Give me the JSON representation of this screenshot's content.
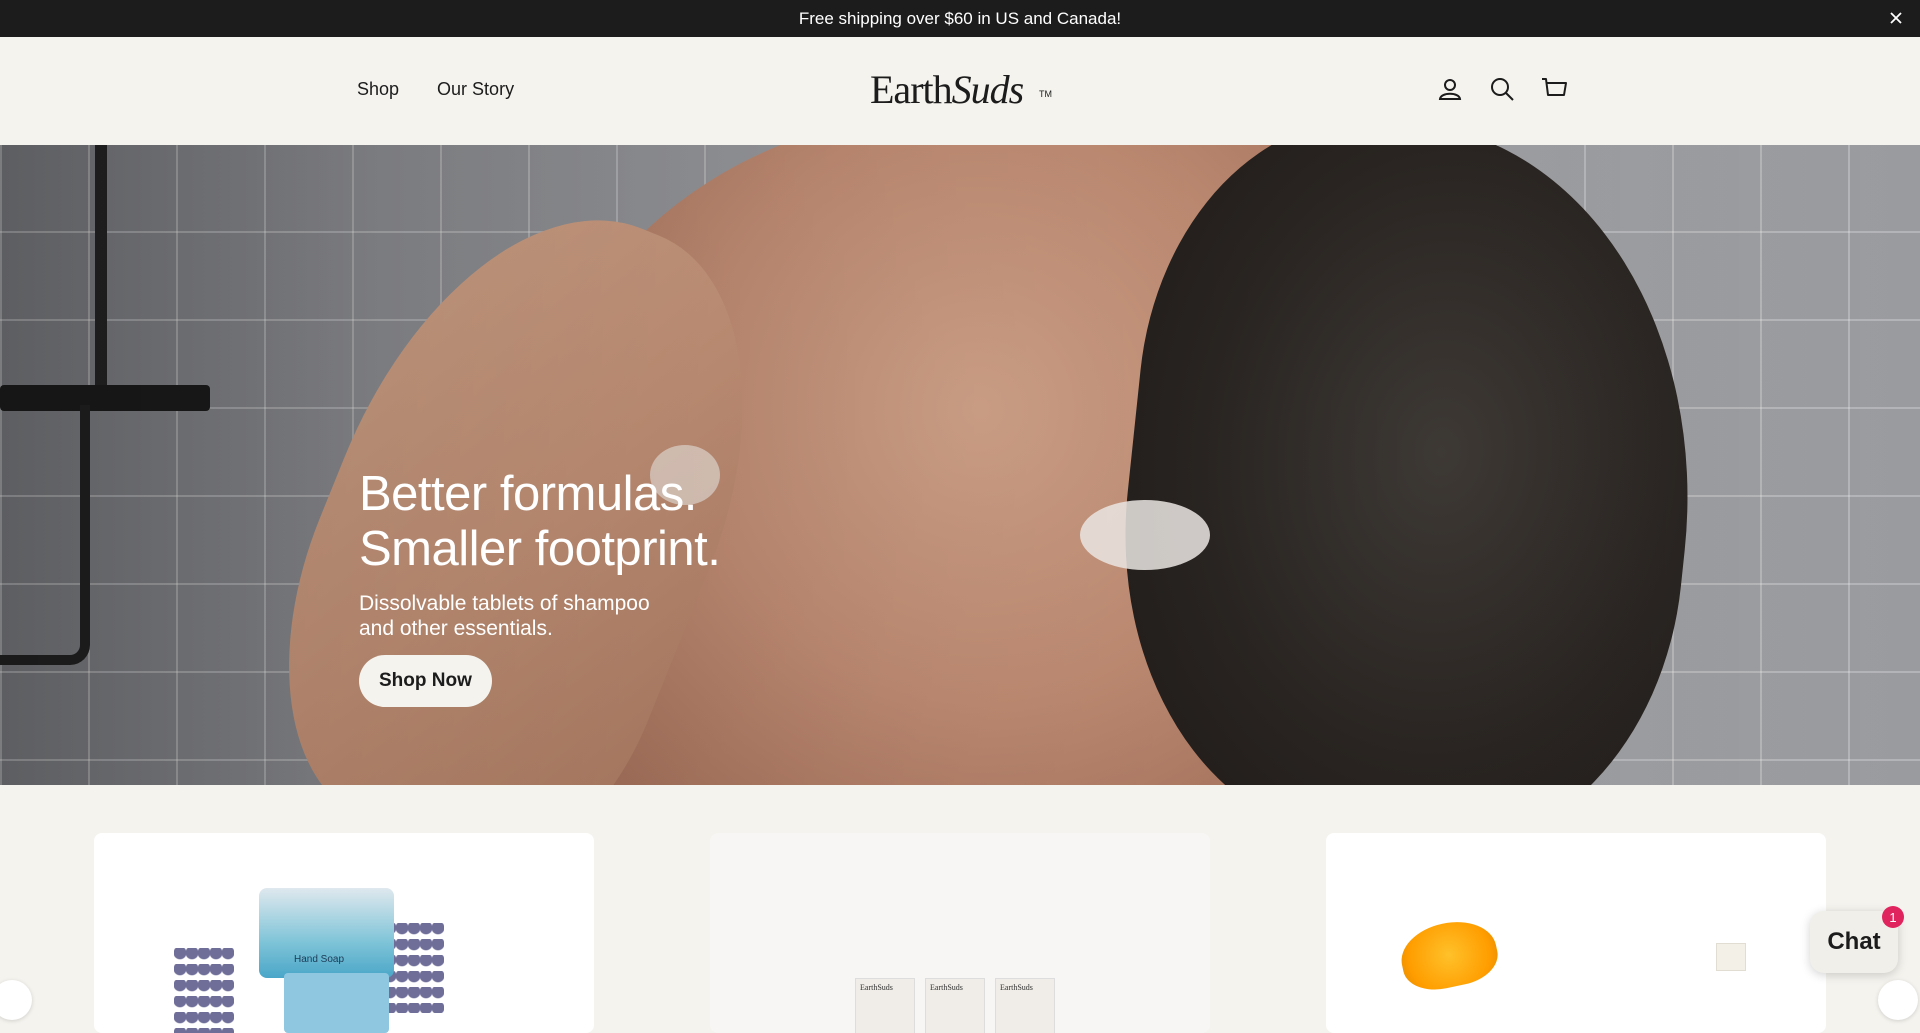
{
  "announcement": {
    "text": "Free shipping over $60 in US and Canada!",
    "close_icon": "close-icon"
  },
  "header": {
    "nav": [
      {
        "label": "Shop"
      },
      {
        "label": "Our Story"
      }
    ],
    "logo": {
      "part1": "Earth",
      "part2": "Suds",
      "tm": "TM"
    },
    "icons": [
      "account-icon",
      "search-icon",
      "cart-icon"
    ]
  },
  "hero": {
    "title_line1": "Better formulas.",
    "title_line2": "Smaller footprint.",
    "subtitle_line1": "Dissolvable tablets of shampoo",
    "subtitle_line2": "and other essentials.",
    "cta_label": "Shop Now"
  },
  "products": {
    "card1": {
      "tin_label": "Hand Soap"
    },
    "card2": {
      "tab_labels": [
        "EarthSuds",
        "EarthSuds",
        "EarthSuds"
      ]
    }
  },
  "chat": {
    "label": "Chat",
    "badge": "1"
  },
  "colors": {
    "announcement_bg": "#1c1c1c",
    "page_bg": "#f5f3ee",
    "text": "#1c1c1c",
    "chat_badge": "#e0245e"
  }
}
